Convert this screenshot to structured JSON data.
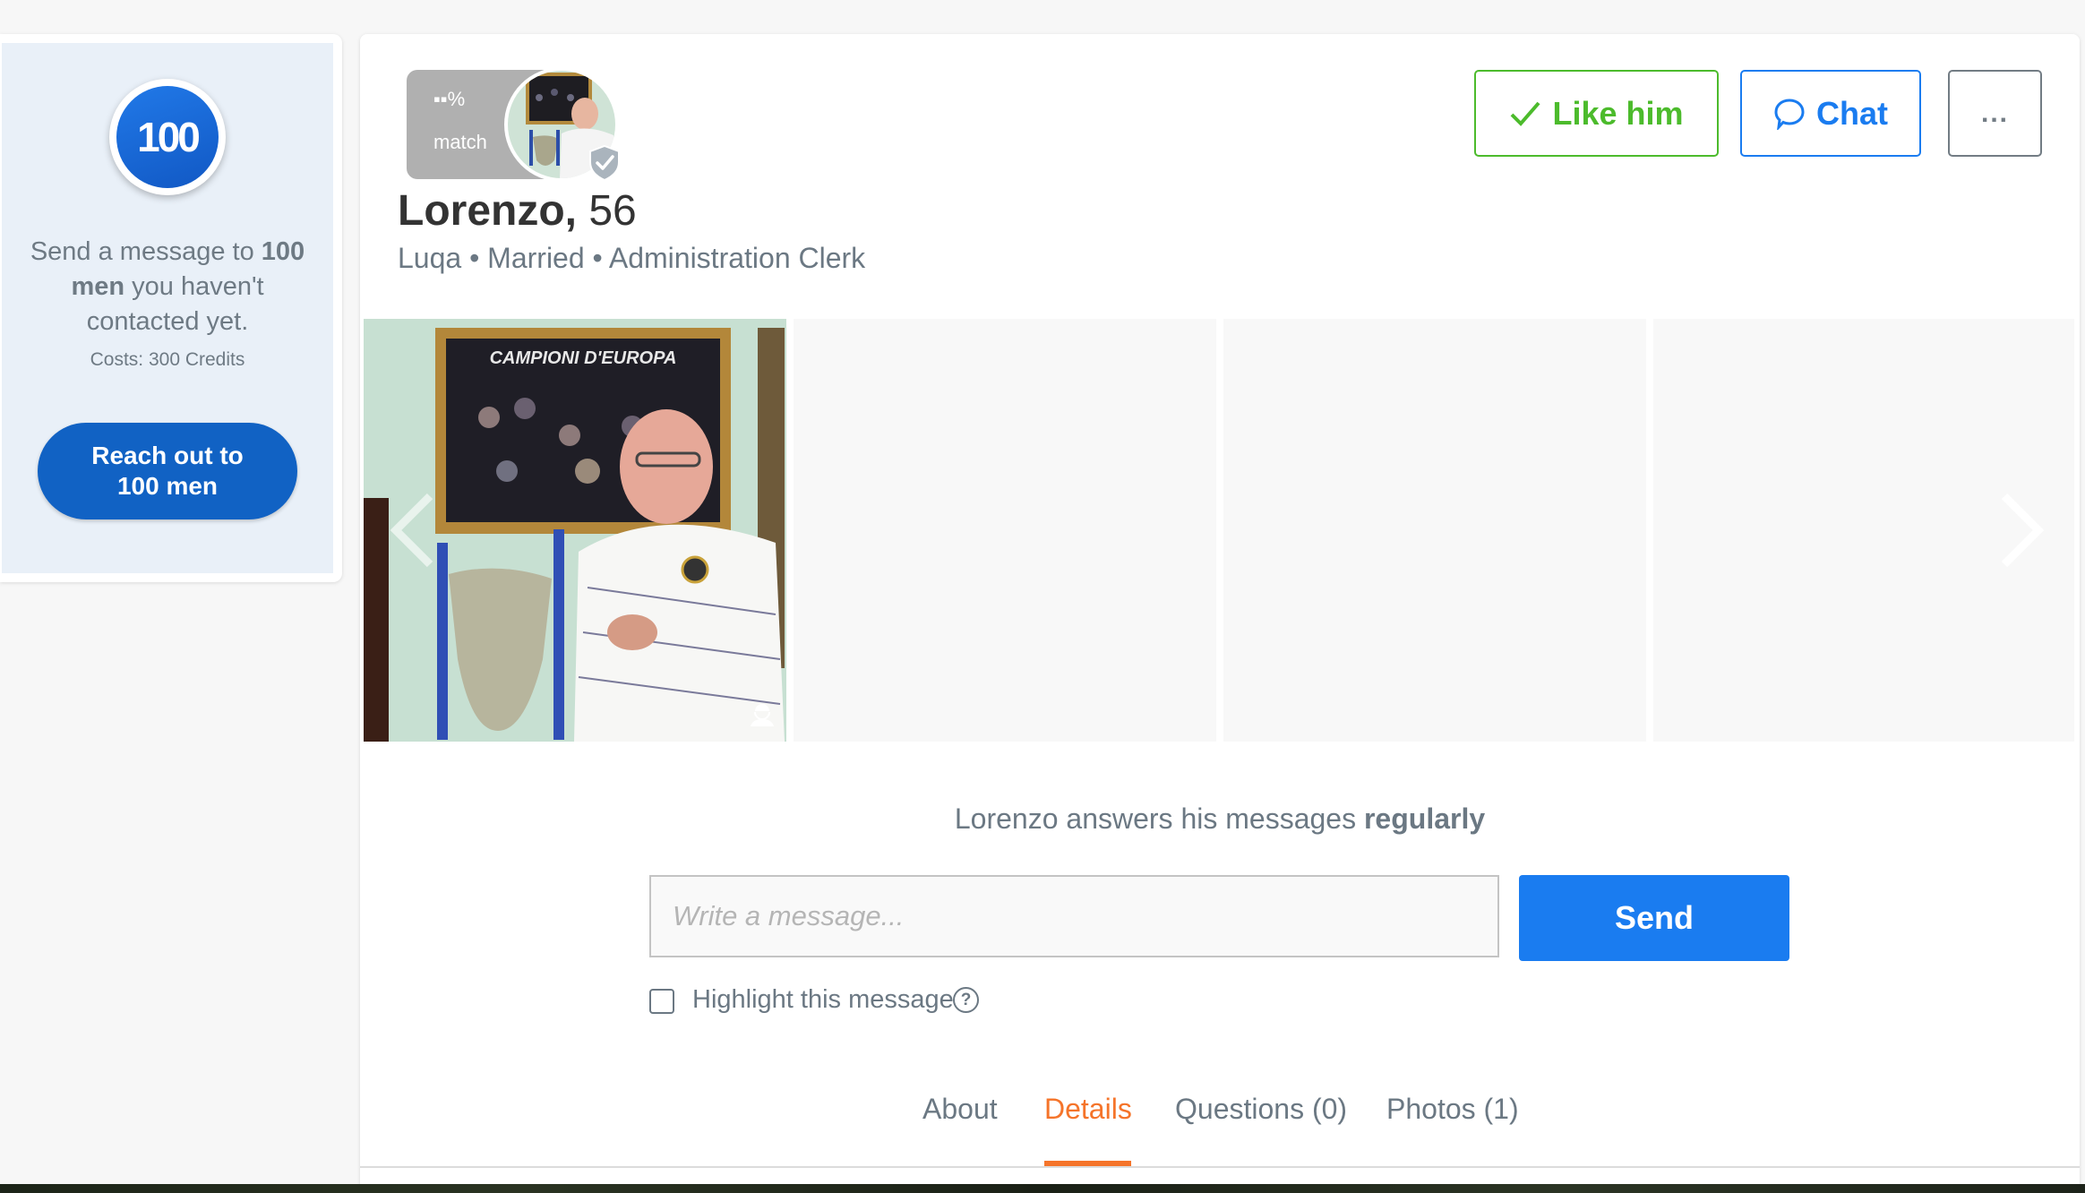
{
  "promo": {
    "logo_text": "100",
    "text_prefix": "Send a message to ",
    "text_bold_1": "100 men",
    "text_suffix": " you haven't contacted yet.",
    "cost": "Costs: 300 Credits",
    "button_label": "Reach out to 100 men",
    "accent_color": "#1162c4"
  },
  "profile": {
    "match_percent": "▪▪%",
    "match_label": "match",
    "name": "Lorenzo,",
    "age": "56",
    "subtitle": "Luqa • Married • Administration Clerk",
    "verified": true,
    "photo_caption": "CAMPIONI D'EUROPA"
  },
  "actions": {
    "like_label": "Like him",
    "like_icon": "check-icon",
    "like_color": "#4cbb2c",
    "chat_label": "Chat",
    "chat_icon": "speech-bubble-icon",
    "chat_color": "#1a7cf0",
    "more_label": "..."
  },
  "photos": {
    "count": 1,
    "tiles": 4
  },
  "messaging": {
    "response_prefix": "Lorenzo answers his messages ",
    "response_bold": "regularly",
    "input_value": "",
    "input_placeholder": "Write a message...",
    "send_label": "Send",
    "highlight_label": "Highlight this message",
    "highlight_checked": false,
    "help_glyph": "?"
  },
  "tabs": [
    {
      "label": "About",
      "active": false
    },
    {
      "label": "Details",
      "active": true
    },
    {
      "label": "Questions (0)",
      "active": false
    },
    {
      "label": "Photos (1)",
      "active": false
    }
  ],
  "colors": {
    "active_tab": "#f5742a",
    "muted_text": "#6b7883"
  }
}
